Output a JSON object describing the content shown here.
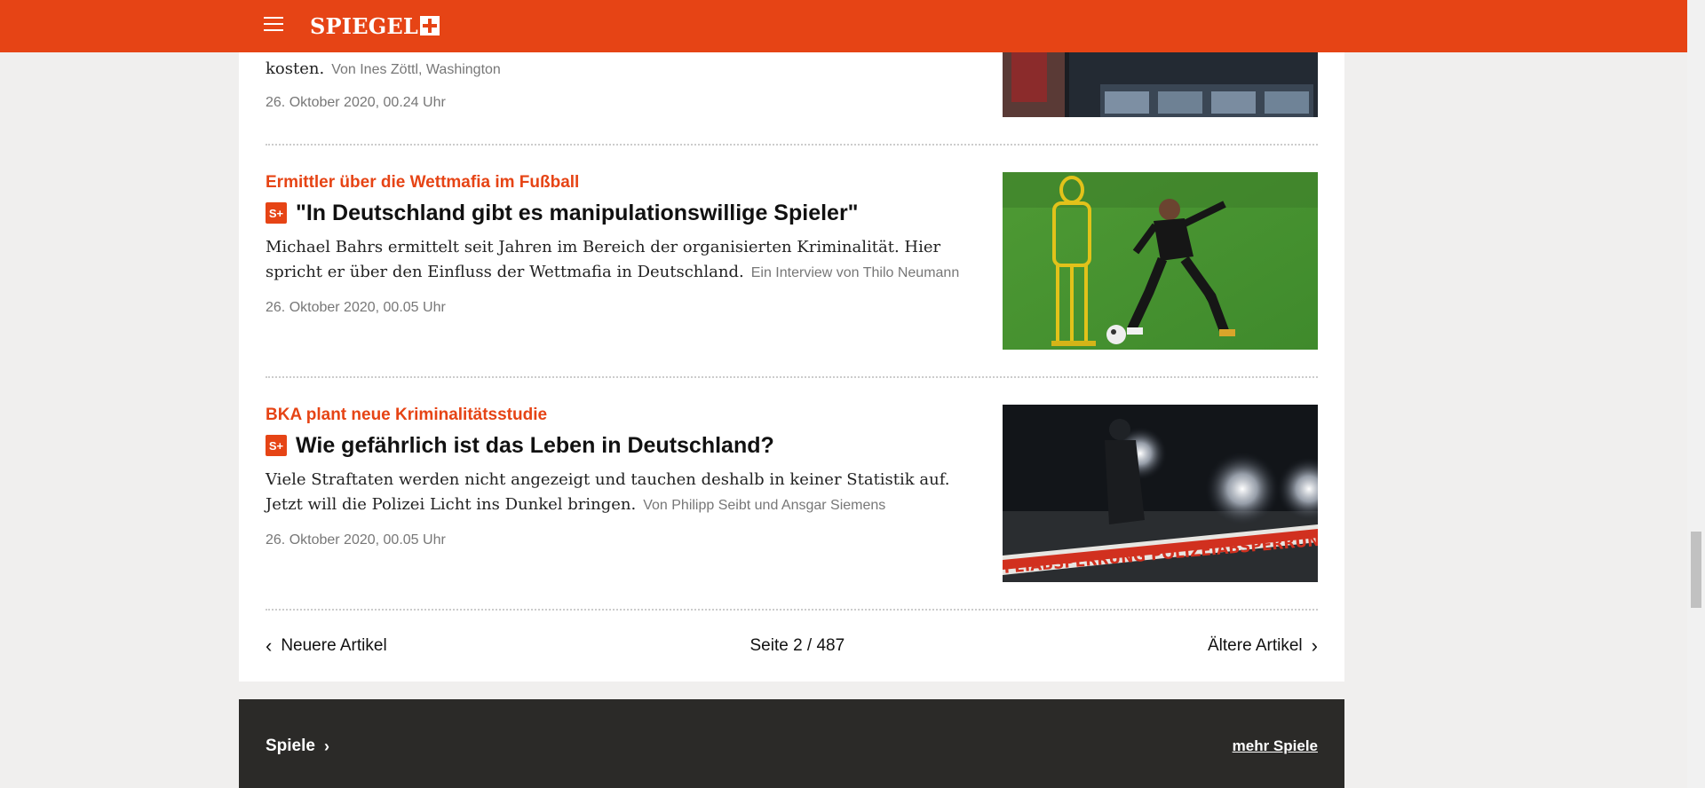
{
  "brand": {
    "name": "SPIEGEL",
    "plus_icon": "spiegel-plus-icon",
    "accent_color": "#e64415"
  },
  "articles": [
    {
      "kicker": "",
      "headline": "",
      "teaser_end": "kosten.",
      "author": "Von Ines Zöttl, Washington",
      "date": "26. Oktober 2020, 00.24 Uhr"
    },
    {
      "kicker": "Ermittler über die Wettmafia im Fußball",
      "badge": "S+",
      "headline": "\"In Deutschland gibt es manipulationswillige Spieler\"",
      "teaser": "Michael Bahrs ermittelt seit Jahren im Bereich der organisierten Kriminalität. Hier spricht er über den Einfluss der Wettmafia in Deutschland.",
      "author": "Ein Interview von Thilo Neumann",
      "date": "26. Oktober 2020, 00.05 Uhr"
    },
    {
      "kicker": "BKA plant neue Kriminalitätsstudie",
      "badge": "S+",
      "headline": "Wie gefährlich ist das Leben in Deutschland?",
      "teaser": "Viele Straftaten werden nicht angezeigt und tauchen deshalb in keiner Statistik auf. Jetzt will die Polizei Licht ins Dunkel bringen.",
      "author": "Von Philipp Seibt und Ansgar Siemens",
      "date": "26. Oktober 2020, 00.05 Uhr",
      "image_tape_text": "FEIABSPERRUNG POLIZEIABSPERRUNG"
    }
  ],
  "pagination": {
    "newer": "Neuere Artikel",
    "page": "Seite 2 / 487",
    "older": "Ältere Artikel"
  },
  "games": {
    "title": "Spiele",
    "more": "mehr Spiele"
  }
}
